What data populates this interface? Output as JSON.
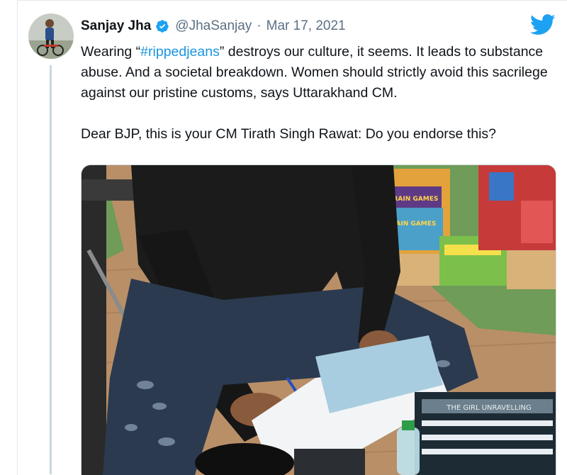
{
  "tweet": {
    "author_name": "Sanjay Jha",
    "handle": "@JhaSanjay",
    "separator": "·",
    "date": "Mar 17, 2021",
    "text_line1_before": "Wearing “",
    "hashtag": "#rippedjeans",
    "text_line1_after": "” destroys our culture, it seems. It leads to substance abuse. And a societal breakdown. Women should strictly avoid this sacrilege against our pristine customs, says Uttarakhand CM.",
    "text_paragraph2": "Dear BJP, this is your CM Tirath Singh Rawat: Do you endorse this?"
  },
  "colors": {
    "twitter_blue": "#1da1f2",
    "hashtag": "#1b95e0",
    "secondary_text": "#5b7083"
  },
  "icons": {
    "verified": "verified-badge-icon",
    "brand": "twitter-bird-icon"
  },
  "media": {
    "book_cover_texts": [
      "BRAIN GAMES",
      "BRAIN GAMES",
      "THE GIRL UNRAVELLING"
    ]
  }
}
